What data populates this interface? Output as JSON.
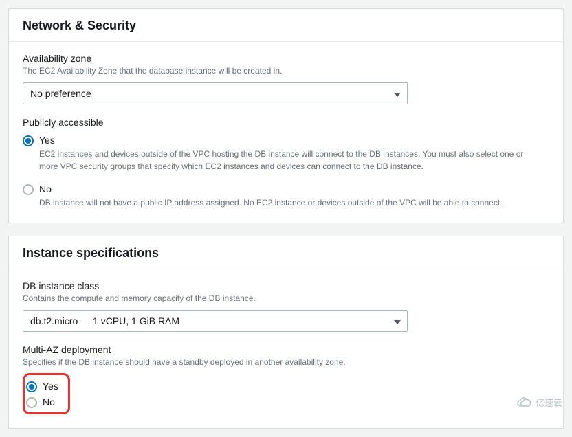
{
  "network": {
    "title": "Network & Security",
    "az": {
      "label": "Availability zone",
      "help": "The EC2 Availability Zone that the database instance will be created in.",
      "value": "No preference"
    },
    "public": {
      "label": "Publicly accessible",
      "yes": {
        "label": "Yes",
        "desc": "EC2 instances and devices outside of the VPC hosting the DB instance will connect to the DB instances. You must also select one or more VPC security groups that specify which EC2 instances and devices can connect to the DB instance."
      },
      "no": {
        "label": "No",
        "desc": "DB instance will not have a public IP address assigned. No EC2 instance or devices outside of the VPC will be able to connect."
      },
      "selected": "yes"
    }
  },
  "instance": {
    "title": "Instance specifications",
    "class": {
      "label": "DB instance class",
      "help": "Contains the compute and memory capacity of the DB instance.",
      "value": "db.t2.micro — 1 vCPU, 1 GiB RAM"
    },
    "multiaz": {
      "label": "Multi-AZ deployment",
      "help": "Specifies if the DB instance should have a standby deployed in another availability zone.",
      "yes": {
        "label": "Yes"
      },
      "no": {
        "label": "No"
      },
      "selected": "yes"
    }
  },
  "watermark": "亿速云"
}
